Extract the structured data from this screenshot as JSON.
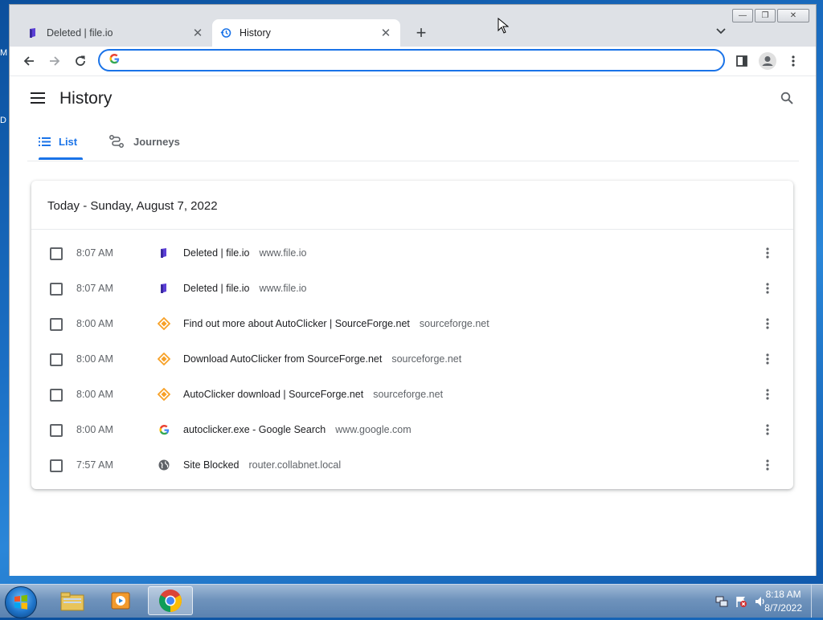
{
  "browser": {
    "tabs": [
      {
        "label": "Deleted | file.io",
        "icon": "fileio-favicon",
        "active": false
      },
      {
        "label": "History",
        "icon": "history-icon",
        "active": true
      }
    ],
    "omnibox": {
      "value": "",
      "placeholder": ""
    }
  },
  "history": {
    "title": "History",
    "nav": {
      "list_label": "List",
      "journeys_label": "Journeys"
    },
    "date_heading": "Today - Sunday, August 7, 2022",
    "items": [
      {
        "time": "8:07 AM",
        "title": "Deleted | file.io",
        "domain": "www.file.io",
        "icon": "fileio-favicon"
      },
      {
        "time": "8:07 AM",
        "title": "Deleted | file.io",
        "domain": "www.file.io",
        "icon": "fileio-favicon"
      },
      {
        "time": "8:00 AM",
        "title": "Find out more about AutoClicker | SourceForge.net",
        "domain": "sourceforge.net",
        "icon": "sourceforge-favicon"
      },
      {
        "time": "8:00 AM",
        "title": "Download AutoClicker from SourceForge.net",
        "domain": "sourceforge.net",
        "icon": "sourceforge-favicon"
      },
      {
        "time": "8:00 AM",
        "title": "AutoClicker download | SourceForge.net",
        "domain": "sourceforge.net",
        "icon": "sourceforge-favicon"
      },
      {
        "time": "8:00 AM",
        "title": "autoclicker.exe - Google Search",
        "domain": "www.google.com",
        "icon": "google-favicon"
      },
      {
        "time": "7:57 AM",
        "title": "Site Blocked",
        "domain": "router.collabnet.local",
        "icon": "globe-icon"
      }
    ]
  },
  "taskbar": {
    "clock_time": "8:18 AM",
    "clock_date": "8/7/2022"
  },
  "colors": {
    "accent": "#1a73e8",
    "sourceforge": "#f7a128",
    "fileio": "#5b3fd6"
  }
}
